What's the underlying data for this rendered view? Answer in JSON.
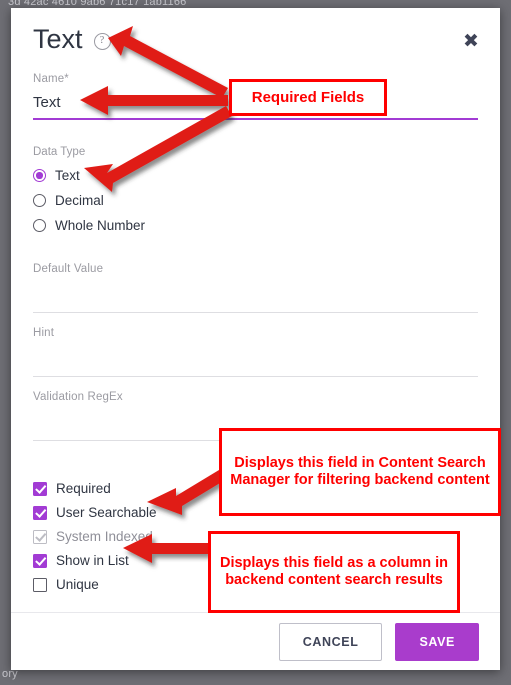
{
  "background": {
    "top_text": "3d  42ac  4610  9ab6  71c17 1ab1166",
    "bottom_text": "ory"
  },
  "dialog": {
    "title": "Text",
    "help_icon": "?",
    "close_icon": "✖",
    "name_field": {
      "label": "Name*",
      "value": "Text"
    },
    "data_type": {
      "label": "Data Type",
      "options": [
        {
          "label": "Text",
          "selected": true
        },
        {
          "label": "Decimal",
          "selected": false
        },
        {
          "label": "Whole Number",
          "selected": false
        }
      ]
    },
    "text_fields": [
      {
        "label": "Default Value",
        "value": ""
      },
      {
        "label": "Hint",
        "value": ""
      },
      {
        "label": "Validation RegEx",
        "value": ""
      }
    ],
    "checkboxes": [
      {
        "label": "Required",
        "checked": true,
        "disabled": false
      },
      {
        "label": "User Searchable",
        "checked": true,
        "disabled": false
      },
      {
        "label": "System Indexed",
        "checked": true,
        "disabled": true
      },
      {
        "label": "Show in List",
        "checked": true,
        "disabled": false
      },
      {
        "label": "Unique",
        "checked": false,
        "disabled": false
      }
    ],
    "footer": {
      "cancel_label": "CANCEL",
      "save_label": "SAVE"
    }
  },
  "annotations": [
    {
      "id": "required",
      "text": "Required Fields"
    },
    {
      "id": "search",
      "text": "Displays this field in Content Search Manager for filtering backend content"
    },
    {
      "id": "column",
      "text": "Displays this field as a column in backend content search results"
    }
  ],
  "colors": {
    "accent_purple": "#a93ccc",
    "annotation_red": "#ff0000",
    "dark_text": "#2f3542",
    "muted_label": "#9b9ba2",
    "backdrop": "#6e6e74"
  }
}
